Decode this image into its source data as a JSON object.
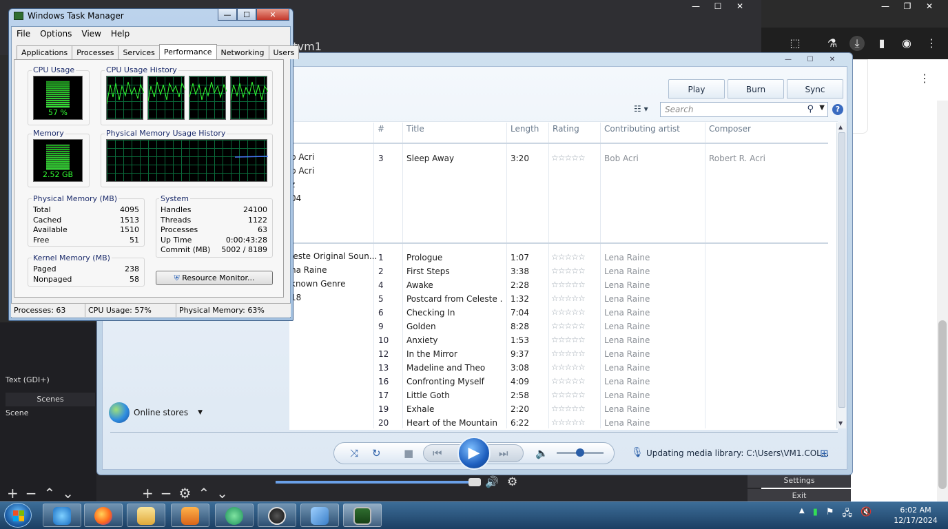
{
  "obs": {
    "url_fragment": "/tvm1",
    "source_item": "Text (GDI+)",
    "scenes_header": "Scenes",
    "scene_item": "Scene",
    "settings_label": "Settings",
    "exit_label": "Exit"
  },
  "task_manager": {
    "title": "Windows Task Manager",
    "menu": [
      "File",
      "Options",
      "View",
      "Help"
    ],
    "tabs": [
      "Applications",
      "Processes",
      "Services",
      "Performance",
      "Networking",
      "Users"
    ],
    "active_tab": "Performance",
    "cpu_usage_label": "CPU Usage",
    "cpu_usage_value": "57 %",
    "cpu_history_label": "CPU Usage History",
    "memory_label": "Memory",
    "memory_value": "2.52 GB",
    "memory_history_label": "Physical Memory Usage History",
    "physical_memory": {
      "label": "Physical Memory (MB)",
      "rows": [
        {
          "name": "Total",
          "value": "4095"
        },
        {
          "name": "Cached",
          "value": "1513"
        },
        {
          "name": "Available",
          "value": "1510"
        },
        {
          "name": "Free",
          "value": "51"
        }
      ]
    },
    "system": {
      "label": "System",
      "rows": [
        {
          "name": "Handles",
          "value": "24100"
        },
        {
          "name": "Threads",
          "value": "1122"
        },
        {
          "name": "Processes",
          "value": "63"
        },
        {
          "name": "Up Time",
          "value": "0:00:43:28"
        },
        {
          "name": "Commit (MB)",
          "value": "5002 / 8189"
        }
      ]
    },
    "kernel_memory": {
      "label": "Kernel Memory (MB)",
      "rows": [
        {
          "name": "Paged",
          "value": "238"
        },
        {
          "name": "Nonpaged",
          "value": "58"
        }
      ]
    },
    "resource_monitor_label": "Resource Monitor...",
    "status": {
      "processes": "Processes: 63",
      "cpu": "CPU Usage: 57%",
      "memory": "Physical Memory: 63%"
    },
    "cpu_percent": 57,
    "memory_percent": 63
  },
  "wmp": {
    "tabs": [
      "Play",
      "Burn",
      "Sync"
    ],
    "search_placeholder": "Search",
    "columns": [
      "#",
      "Title",
      "Length",
      "Rating",
      "Contributing artist",
      "Composer"
    ],
    "album1_info": [
      "b Acri",
      "b Acri",
      "z",
      "04"
    ],
    "album2_info": [
      "leste Original Soun...",
      "na Raine",
      "known Genre",
      "18"
    ],
    "tracks_group1": [
      {
        "num": "3",
        "title": "Sleep Away",
        "length": "3:20",
        "artist": "Bob Acri",
        "composer": "Robert R. Acri"
      }
    ],
    "tracks_group2": [
      {
        "num": "1",
        "title": "Prologue",
        "length": "1:07",
        "artist": "Lena Raine"
      },
      {
        "num": "2",
        "title": "First Steps",
        "length": "3:38",
        "artist": "Lena Raine"
      },
      {
        "num": "4",
        "title": "Awake",
        "length": "2:28",
        "artist": "Lena Raine"
      },
      {
        "num": "5",
        "title": "Postcard from Celeste ...",
        "length": "1:32",
        "artist": "Lena Raine"
      },
      {
        "num": "6",
        "title": "Checking In",
        "length": "7:04",
        "artist": "Lena Raine"
      },
      {
        "num": "9",
        "title": "Golden",
        "length": "8:28",
        "artist": "Lena Raine"
      },
      {
        "num": "10",
        "title": "Anxiety",
        "length": "1:53",
        "artist": "Lena Raine"
      },
      {
        "num": "12",
        "title": "In the Mirror",
        "length": "9:37",
        "artist": "Lena Raine"
      },
      {
        "num": "13",
        "title": "Madeline and Theo",
        "length": "3:08",
        "artist": "Lena Raine"
      },
      {
        "num": "16",
        "title": "Confronting Myself",
        "length": "4:09",
        "artist": "Lena Raine"
      },
      {
        "num": "17",
        "title": "Little Goth",
        "length": "2:58",
        "artist": "Lena Raine"
      },
      {
        "num": "19",
        "title": "Exhale",
        "length": "2:20",
        "artist": "Lena Raine"
      },
      {
        "num": "20",
        "title": "Heart of the Mountain",
        "length": "6:22",
        "artist": "Lena Raine"
      }
    ],
    "rating_stars": "☆☆☆☆☆",
    "online_stores_label": "Online stores",
    "status_text": "Updating media library: C:\\Users\\VM1.COL..."
  },
  "taskbar": {
    "time": "6:02 AM",
    "date": "12/17/2024"
  }
}
